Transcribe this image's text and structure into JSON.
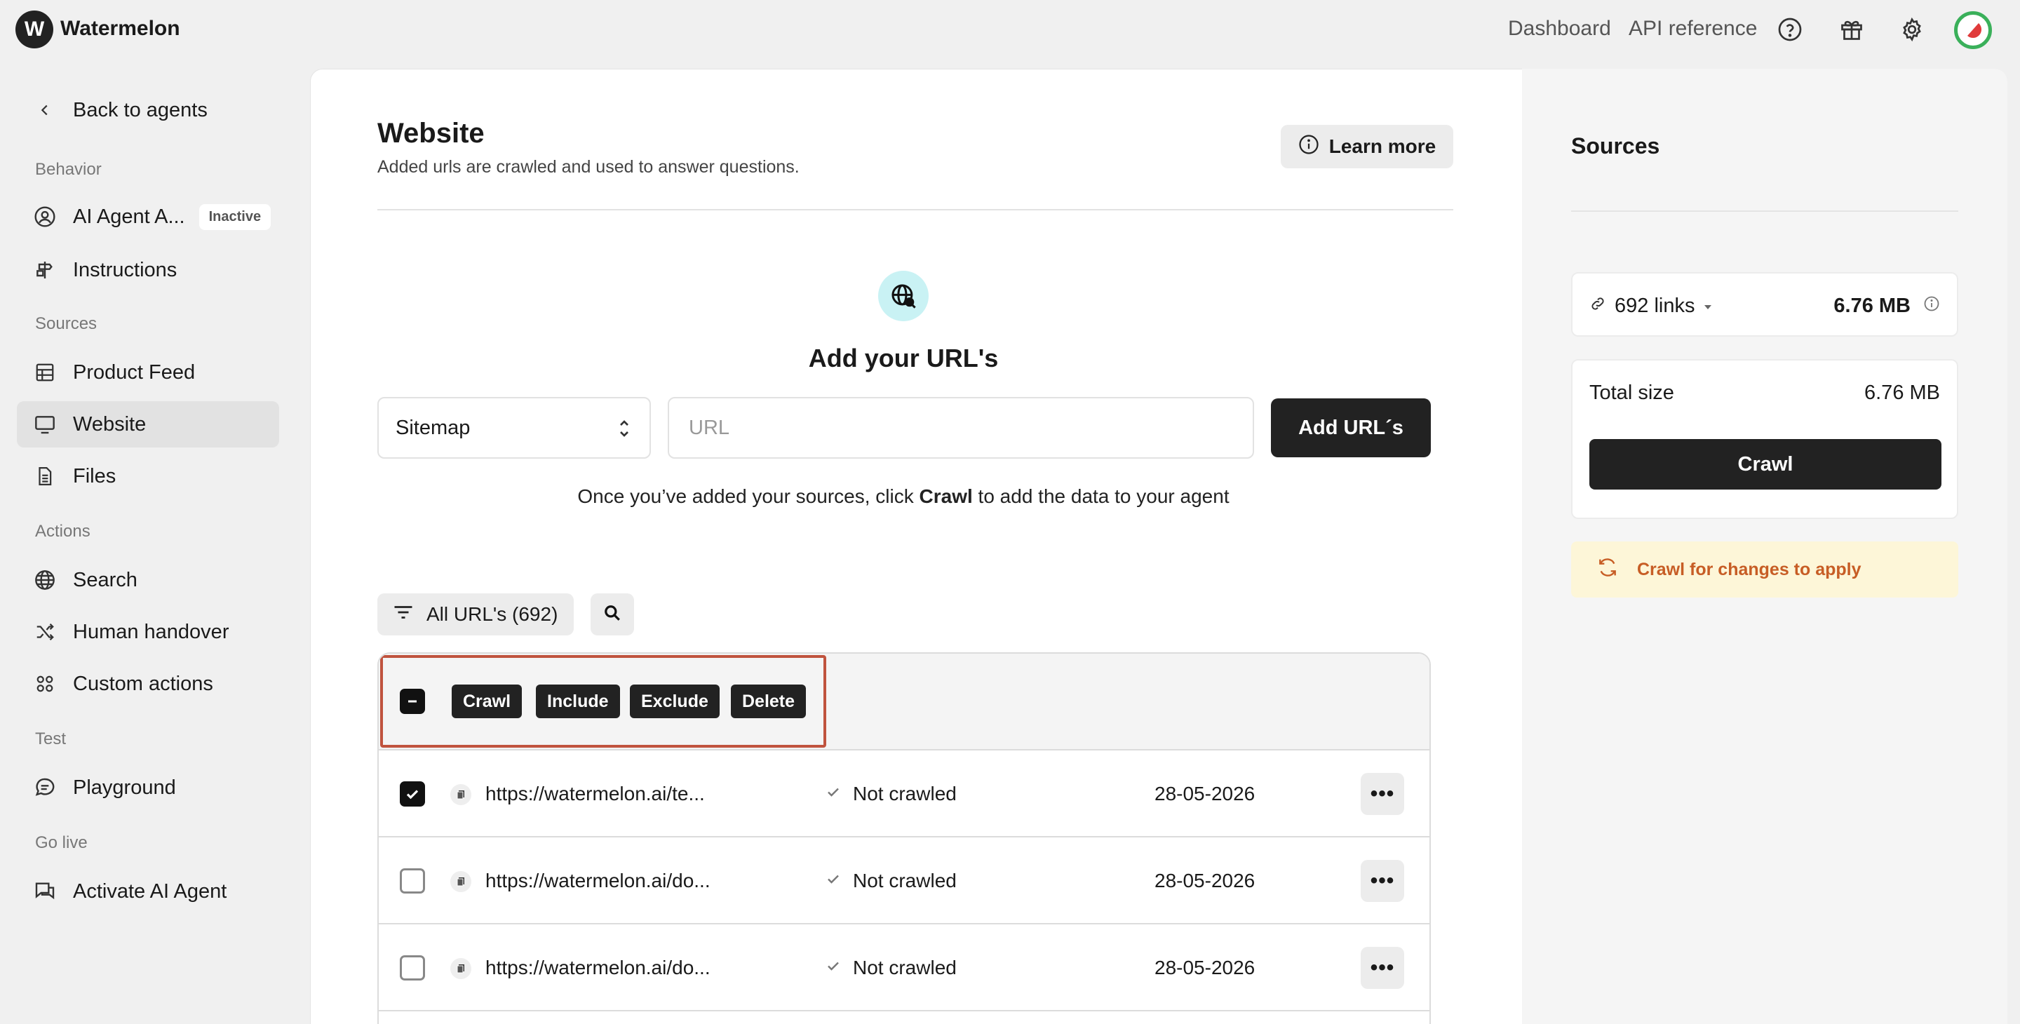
{
  "app": {
    "logo_letter": "W",
    "name": "Watermelon"
  },
  "topnav": {
    "dashboard": "Dashboard",
    "api_reference": "API reference"
  },
  "sidebar": {
    "back": "Back to agents",
    "sections": {
      "behavior": "Behavior",
      "sources": "Sources",
      "actions": "Actions",
      "test": "Test",
      "golive": "Go live"
    },
    "items": {
      "agent": "AI Agent A...",
      "agent_badge": "Inactive",
      "instructions": "Instructions",
      "product_feed": "Product Feed",
      "website": "Website",
      "files": "Files",
      "search": "Search",
      "human_handover": "Human handover",
      "custom_actions": "Custom actions",
      "playground": "Playground",
      "activate": "Activate AI Agent"
    }
  },
  "main": {
    "title": "Website",
    "subtitle": "Added urls are crawled and used to answer questions.",
    "learn_more": "Learn more",
    "add_title": "Add your URL's",
    "select_value": "Sitemap",
    "url_placeholder": "URL",
    "add_button": "Add URL´s",
    "hint_pre": "Once you’ve added your sources, click ",
    "hint_bold": "Crawl",
    "hint_post": " to add the data to your agent",
    "filter_label": "All URL's (692)",
    "bulk": {
      "crawl": "Crawl",
      "include": "Include",
      "exclude": "Exclude",
      "delete": "Delete"
    },
    "rows": [
      {
        "url": "https://watermelon.ai/te...",
        "status": "Not crawled",
        "date": "28-05-2026",
        "checked": true
      },
      {
        "url": "https://watermelon.ai/do...",
        "status": "Not crawled",
        "date": "28-05-2026",
        "checked": false
      },
      {
        "url": "https://watermelon.ai/do...",
        "status": "Not crawled",
        "date": "28-05-2026",
        "checked": false
      }
    ]
  },
  "sources_panel": {
    "title": "Sources",
    "links": "692 links",
    "links_size": "6.76 MB",
    "total_label": "Total size",
    "total_value": "6.76 MB",
    "crawl": "Crawl",
    "warning": "Crawl for changes to apply"
  },
  "colors": {
    "accent": "#222222",
    "highlight_frame": "#c0533e",
    "warning_bg": "#fdf6d8",
    "warning_text": "#c75d25",
    "globe_bg": "#c9f2f4"
  }
}
